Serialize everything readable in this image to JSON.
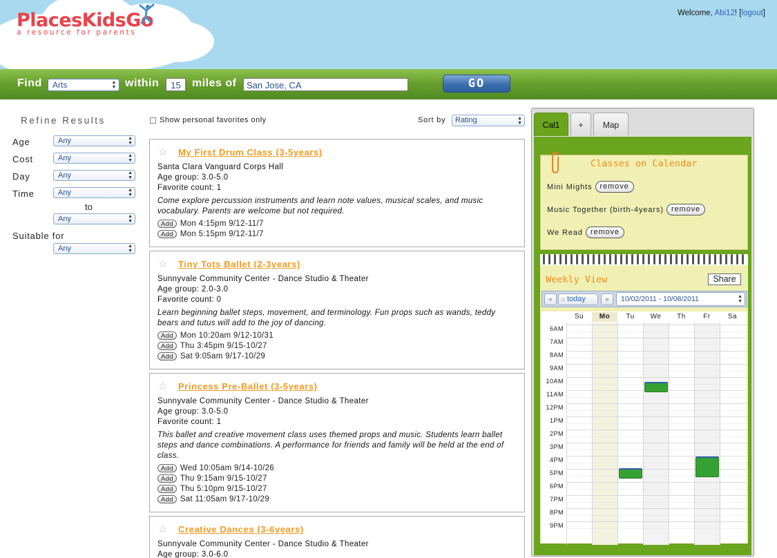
{
  "header": {
    "logo_text": "PlacesKidsGo",
    "tagline": "a resource for parents",
    "welcome_prefix": "Welcome, ",
    "username": "Abi12",
    "welcome_suffix": "! [",
    "logout": "logout",
    "logout_close": "]"
  },
  "findbar": {
    "find_label": "Find",
    "category": "Arts",
    "within_label": "within",
    "miles": "15",
    "miles_label": "miles of",
    "location": "San Jose, CA",
    "go_label": "GO"
  },
  "refine": {
    "title": "Refine Results",
    "filters": [
      {
        "label": "Age",
        "value": "Any"
      },
      {
        "label": "Cost",
        "value": "Any"
      },
      {
        "label": "Day",
        "value": "Any"
      },
      {
        "label": "Time",
        "value": "Any"
      }
    ],
    "to_label": "to",
    "time_to_value": "Any",
    "suitable_label": "Suitable for",
    "suitable_value": "Any"
  },
  "results_toolbar": {
    "favorites_only": "Show personal favorites only",
    "sort_label": "Sort by",
    "sort_value": "Rating"
  },
  "add_label": "Add",
  "results": [
    {
      "title": "My First Drum Class (3-5years)",
      "venue": "Santa Clara Vanguard Corps Hall",
      "age_group": "Age group: 3.0-5.0",
      "favorites": "Favorite count: 1",
      "description": "Come explore percussion instruments and learn note values, musical scales, and music vocabulary. Parents are welcome but not required.",
      "sessions": [
        "Mon 4:15pm 9/12-11/7",
        "Mon 5:15pm 9/12-11/7"
      ]
    },
    {
      "title": "Tiny Tots Ballet (2-3years)",
      "venue": "Sunnyvale Community Center - Dance Studio & Theater",
      "age_group": "Age group: 2.0-3.0",
      "favorites": "Favorite count: 0",
      "description": "Learn beginning ballet steps, movement, and terminology. Fun props such as wands, teddy bears and tutus will add to the joy of dancing.",
      "sessions": [
        "Mon 10:20am 9/12-10/31",
        "Thu 3:45pm 9/15-10/27",
        "Sat 9:05am 9/17-10/29"
      ]
    },
    {
      "title": "Princess Pre-Ballet (3-5years)",
      "venue": "Sunnyvale Community Center - Dance Studio & Theater",
      "age_group": "Age group: 3.0-5.0",
      "favorites": "Favorite count: 1",
      "description": "This ballet and creative movement class uses themed props and music. Students learn ballet steps and dance combinations. A performance for friends and family will be held at the end of class.",
      "sessions": [
        "Wed 10:05am 9/14-10/26",
        "Thu 9:15am 9/15-10/27",
        "Thu 5:10pm 9/15-10/27",
        "Sat 11:05am 9/17-10/29"
      ]
    },
    {
      "title": "Creative Dances (3-6years)",
      "venue": "Sunnyvale Community Center - Dance Studio & Theater",
      "age_group": "Age group: 3.0-6.0"
    }
  ],
  "sidepanel": {
    "tabs": [
      "Cal1",
      "+",
      "Map"
    ],
    "classes_title": "Classes on Calendar",
    "remove_label": "remove",
    "classes": [
      "Mini Mights",
      "Music Together (birth-4years)",
      "We Read"
    ],
    "weekly_title": "Weekly View",
    "share_label": "Share",
    "prev_icon": "«",
    "next_icon": "»",
    "today_label": "today",
    "date_range": "10/02/2011 - 10/08/2011",
    "days": [
      "Su",
      "Mo",
      "Tu",
      "We",
      "Th",
      "Fr",
      "Sa"
    ],
    "highlight_day": "Mo",
    "hours": [
      "6AM",
      "7AM",
      "8AM",
      "9AM",
      "10AM",
      "11AM",
      "12PM",
      "1PM",
      "2PM",
      "3PM",
      "4PM",
      "5PM",
      "6PM",
      "7PM",
      "8PM",
      "9PM"
    ],
    "events": [
      {
        "day": "We",
        "start_hour": 10.3,
        "end_hour": 11.1
      },
      {
        "day": "Tu",
        "start_hour": 16.9,
        "end_hour": 17.7
      },
      {
        "day": "Fr",
        "start_hour": 16.0,
        "end_hour": 17.6
      }
    ],
    "event_color": "#36a133"
  },
  "colors": {
    "sky": "#a9d9ef",
    "brand": "#e8434b",
    "find_bar": "#6aa02f",
    "title_link": "#f09a1f",
    "calendar_green": "#6ba41d",
    "note_yellow": "#f1f0b4"
  }
}
